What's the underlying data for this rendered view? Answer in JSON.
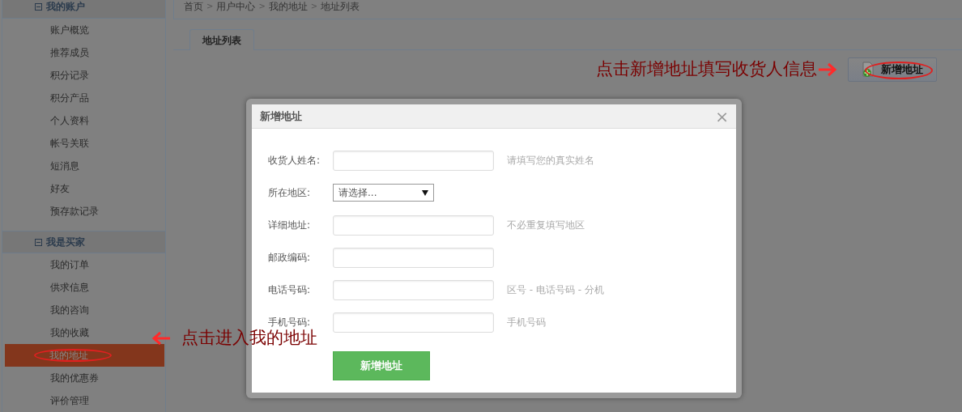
{
  "sidebar": {
    "groups": [
      {
        "title": "我的账户",
        "expanded": true,
        "items": [
          {
            "label": "账户概览",
            "selected": false
          },
          {
            "label": "推荐成员",
            "selected": false
          },
          {
            "label": "积分记录",
            "selected": false
          },
          {
            "label": "积分产品",
            "selected": false
          },
          {
            "label": "个人资料",
            "selected": false
          },
          {
            "label": "帐号关联",
            "selected": false
          },
          {
            "label": "短消息",
            "selected": false
          },
          {
            "label": "好友",
            "selected": false
          },
          {
            "label": "预存款记录",
            "selected": false
          }
        ]
      },
      {
        "title": "我是买家",
        "expanded": true,
        "items": [
          {
            "label": "我的订单",
            "selected": false
          },
          {
            "label": "供求信息",
            "selected": false
          },
          {
            "label": "我的咨询",
            "selected": false
          },
          {
            "label": "我的收藏",
            "selected": false
          },
          {
            "label": "我的地址",
            "selected": true
          },
          {
            "label": "我的优惠券",
            "selected": false
          },
          {
            "label": "评价管理",
            "selected": false
          }
        ]
      }
    ]
  },
  "breadcrumb": {
    "separator": ">",
    "items": [
      "首页",
      "用户中心",
      "我的地址",
      "地址列表"
    ]
  },
  "tabs": [
    {
      "label": "地址列表",
      "selected": true
    }
  ],
  "add_button": {
    "label": "新增地址"
  },
  "annotations": [
    {
      "text": "点击新增地址填写收货人信息",
      "kind": "rightward"
    },
    {
      "text": "点击进入我的地址",
      "kind": "leftward"
    }
  ],
  "modal": {
    "title": "新增地址",
    "close": "×",
    "fields": [
      {
        "kind": "text",
        "label": "收货人姓名:",
        "hint": "请填写您的真实姓名"
      },
      {
        "kind": "select",
        "label": "所在地区:",
        "value": "请选择..."
      },
      {
        "kind": "text",
        "label": "详细地址:",
        "hint": "不必重复填写地区"
      },
      {
        "kind": "text",
        "label": "邮政编码:"
      },
      {
        "kind": "text",
        "label": "电话号码:",
        "hint": "区号 - 电话号码 - 分机"
      },
      {
        "kind": "text",
        "label": "手机号码:",
        "hint": "手机号码"
      }
    ],
    "submit": "新增地址"
  }
}
